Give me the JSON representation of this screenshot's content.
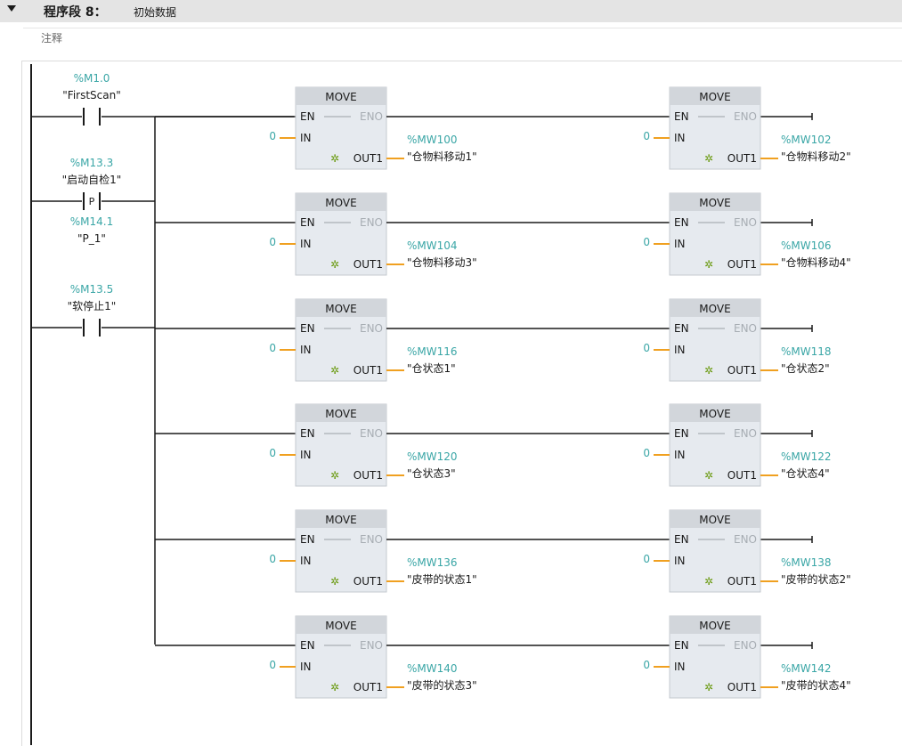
{
  "network": {
    "title": "程序段 8：",
    "description": "初始数据",
    "comment_placeholder": "注释"
  },
  "colors": {
    "operand_teal": "#3aa6a6",
    "wire_orange": "#f0a020",
    "box_fill": "#e6eaef",
    "box_header": "#d2d6db"
  },
  "contacts": [
    {
      "address": "%M1.0",
      "symbol": "\"FirstScan\"",
      "type": "NO"
    },
    {
      "address": "%M13.3",
      "symbol": "\"启动自检1\"",
      "type": "P",
      "edge_label": "P",
      "bit_address": "%M14.1",
      "bit_symbol": "\"P_1\""
    },
    {
      "address": "%M13.5",
      "symbol": "\"软停止1\"",
      "type": "NO"
    }
  ],
  "move_blocks": [
    {
      "row": 0,
      "col": 0,
      "title": "MOVE",
      "en": "EN",
      "eno": "ENO",
      "in_label": "IN",
      "in_value": "0",
      "out_label": "OUT1",
      "out_address": "%MW100",
      "out_symbol": "\"仓物料移动1\""
    },
    {
      "row": 0,
      "col": 1,
      "title": "MOVE",
      "en": "EN",
      "eno": "ENO",
      "in_label": "IN",
      "in_value": "0",
      "out_label": "OUT1",
      "out_address": "%MW102",
      "out_symbol": "\"仓物料移动2\""
    },
    {
      "row": 1,
      "col": 0,
      "title": "MOVE",
      "en": "EN",
      "eno": "ENO",
      "in_label": "IN",
      "in_value": "0",
      "out_label": "OUT1",
      "out_address": "%MW104",
      "out_symbol": "\"仓物料移动3\""
    },
    {
      "row": 1,
      "col": 1,
      "title": "MOVE",
      "en": "EN",
      "eno": "ENO",
      "in_label": "IN",
      "in_value": "0",
      "out_label": "OUT1",
      "out_address": "%MW106",
      "out_symbol": "\"仓物料移动4\""
    },
    {
      "row": 2,
      "col": 0,
      "title": "MOVE",
      "en": "EN",
      "eno": "ENO",
      "in_label": "IN",
      "in_value": "0",
      "out_label": "OUT1",
      "out_address": "%MW116",
      "out_symbol": "\"仓状态1\""
    },
    {
      "row": 2,
      "col": 1,
      "title": "MOVE",
      "en": "EN",
      "eno": "ENO",
      "in_label": "IN",
      "in_value": "0",
      "out_label": "OUT1",
      "out_address": "%MW118",
      "out_symbol": "\"仓状态2\""
    },
    {
      "row": 3,
      "col": 0,
      "title": "MOVE",
      "en": "EN",
      "eno": "ENO",
      "in_label": "IN",
      "in_value": "0",
      "out_label": "OUT1",
      "out_address": "%MW120",
      "out_symbol": "\"仓状态3\""
    },
    {
      "row": 3,
      "col": 1,
      "title": "MOVE",
      "en": "EN",
      "eno": "ENO",
      "in_label": "IN",
      "in_value": "0",
      "out_label": "OUT1",
      "out_address": "%MW122",
      "out_symbol": "\"仓状态4\""
    },
    {
      "row": 4,
      "col": 0,
      "title": "MOVE",
      "en": "EN",
      "eno": "ENO",
      "in_label": "IN",
      "in_value": "0",
      "out_label": "OUT1",
      "out_address": "%MW136",
      "out_symbol": "\"皮带的状态1\""
    },
    {
      "row": 4,
      "col": 1,
      "title": "MOVE",
      "en": "EN",
      "eno": "ENO",
      "in_label": "IN",
      "in_value": "0",
      "out_label": "OUT1",
      "out_address": "%MW138",
      "out_symbol": "\"皮带的状态2\""
    },
    {
      "row": 5,
      "col": 0,
      "title": "MOVE",
      "en": "EN",
      "eno": "ENO",
      "in_label": "IN",
      "in_value": "0",
      "out_label": "OUT1",
      "out_address": "%MW140",
      "out_symbol": "\"皮带的状态3\""
    },
    {
      "row": 5,
      "col": 1,
      "title": "MOVE",
      "en": "EN",
      "eno": "ENO",
      "in_label": "IN",
      "in_value": "0",
      "out_label": "OUT1",
      "out_address": "%MW142",
      "out_symbol": "\"皮带的状态4\""
    }
  ]
}
